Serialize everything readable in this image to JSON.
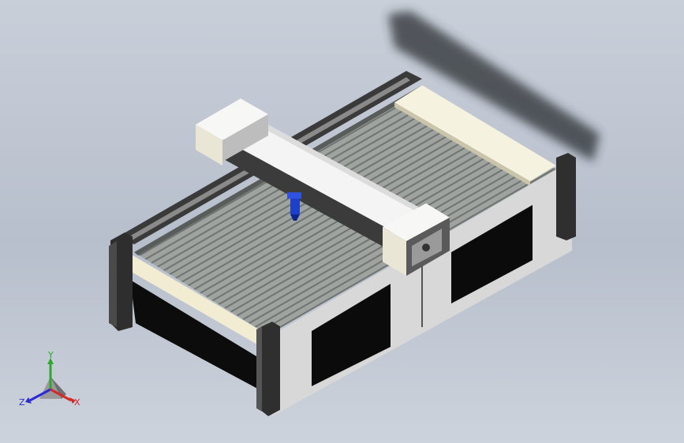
{
  "viewport": {
    "background_top": "#c9cfd9",
    "background_bottom": "#cdd3dc"
  },
  "model": {
    "colors": {
      "frame_light": "#e0e0e0",
      "frame_cream": "#f3efd8",
      "frame_dark": "#353535",
      "bed_slats": "#8f9492",
      "gantry_white": "#f5f5f5",
      "gantry_dark": "#3b3b3b",
      "cutting_head": "#1e3fc8",
      "window_black": "#0b0b0b"
    }
  },
  "triad": {
    "y_label": "Y",
    "z_label": "Z",
    "x_label": "X",
    "y_color": "#2ea82e",
    "z_color": "#2a2ad6",
    "x_color": "#d22a2a"
  }
}
